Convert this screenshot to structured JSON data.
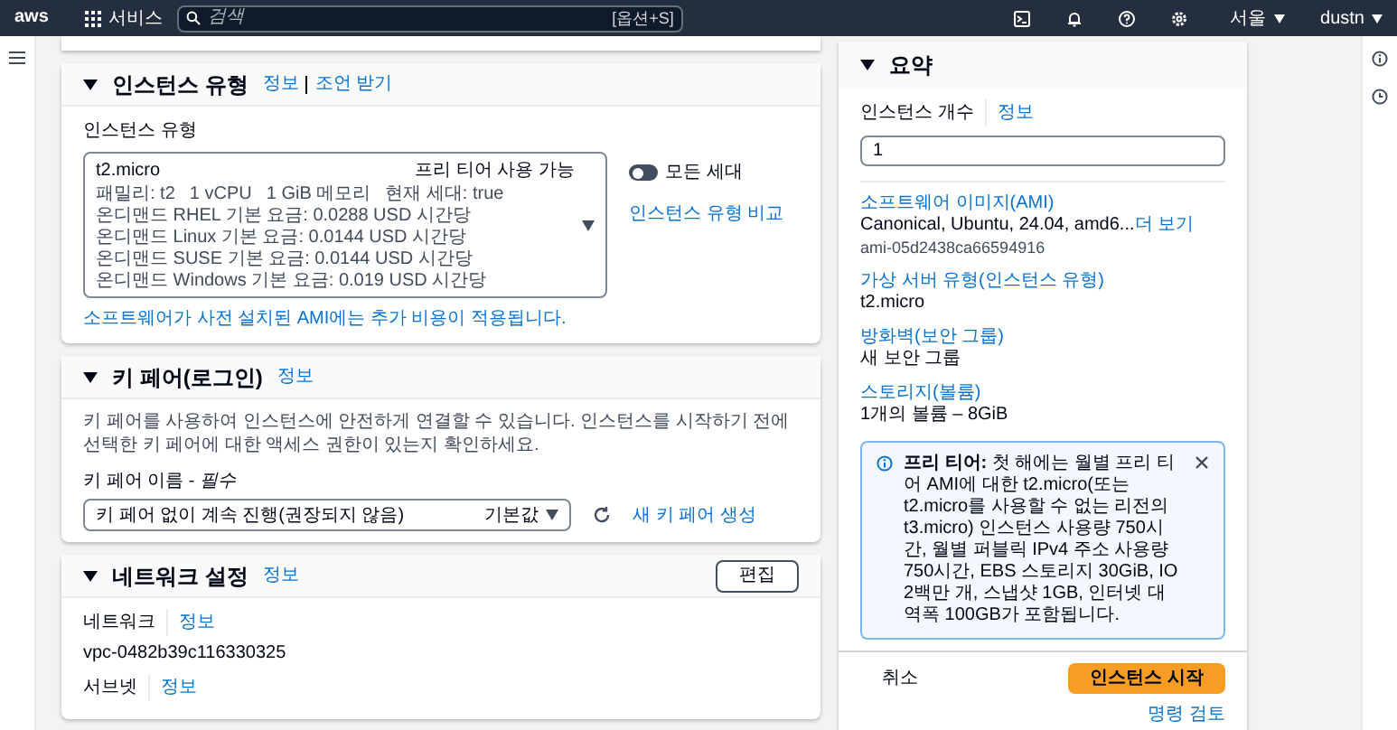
{
  "top_nav": {
    "logo": "aws",
    "services": "서비스",
    "search": {
      "placeholder": "검색",
      "shortcut": "[옵션+S]"
    },
    "region": "서울",
    "user": "dustn"
  },
  "instance_type": {
    "title": "인스턴스 유형",
    "expanded": true,
    "links": [
      "정보",
      "조언 받기"
    ],
    "field_label": "인스턴스 유형",
    "selected_type": "t2.micro",
    "free_tier": "프리 티어 사용 가능",
    "details": [
      "패밀리: t2",
      "1 vCPU",
      "1 GiB 메모리",
      "현재 세대: true",
      "온디맨드 RHEL 기본 요금: 0.0288 USD 시간당",
      "온디맨드 Linux 기본 요금: 0.0144 USD 시간당",
      "온디맨드 SUSE 기본 요금: 0.0144 USD 시간당",
      "온디맨드 Windows 기본 요금: 0.019 USD 시간당"
    ],
    "toggle": {
      "label": "모든 세대",
      "on": false
    },
    "compare_link": "인스턴스 유형 비교",
    "note": "소프트웨어가 사전 설치된 AMI에는 추가 비용이 적용됩니다."
  },
  "key_pair": {
    "title": "키 페어(로그인)",
    "expanded": true,
    "info": "정보",
    "description": "키 페어를 사용하여 인스턴스에 안전하게 연결할 수 있습니다. 인스턴스를 시작하기 전에 선택한 키 페어에 대한 액세스 권한이 있는지 확인하세요.",
    "field_label": "키 페어 이름 - *필수*",
    "value": "키 페어 없이 계속 진행(권장되지 않음)",
    "badge": "기본값",
    "create_link": "새 키 페어 생성"
  },
  "network": {
    "title": "네트워크 설정",
    "expanded": true,
    "info": "정보",
    "edit_button": "편집",
    "fields": [
      {
        "label": "네트워크",
        "info": "정보",
        "value": "vpc-0482b39c116330325"
      },
      {
        "label": "서브넷",
        "info": "정보"
      }
    ]
  },
  "summary": {
    "title": "요약",
    "expanded": true,
    "count_label": "인스턴스 개수",
    "count_info": "정보",
    "count_value": "1",
    "items": [
      {
        "label": "소프트웨어 이미지(AMI)",
        "value": "Canonical, Ubuntu, 24.04, amd6...",
        "more": "더 보기",
        "sub": "ami-05d2438ca66594916"
      },
      {
        "label": "가상 서버 유형(인스턴스 유형)",
        "value": "t2.micro"
      },
      {
        "label": "방화벽(보안 그룹)",
        "value": "새 보안 그룹"
      },
      {
        "label": "스토리지(볼륨)",
        "value": "1개의 볼륨 – 8GiB"
      }
    ],
    "alert": "**프리 티어:** 첫 해에는 월별 프리 티어 AMI에 대한 t2.micro(또는 t2.micro를 사용할 수 없는 리전의 t3.micro) 인스턴스 사용량 750시간, 월별 퍼블릭 IPv4 주소 사용량 750시간, EBS 스토리지 30GiB, IO 2백만 개, 스냅샷 1GB, 인터넷 대역폭 100GB가 포함됩니다.",
    "cancel": "취소",
    "launch": "인스턴스 시작",
    "review": "명령 검토"
  }
}
